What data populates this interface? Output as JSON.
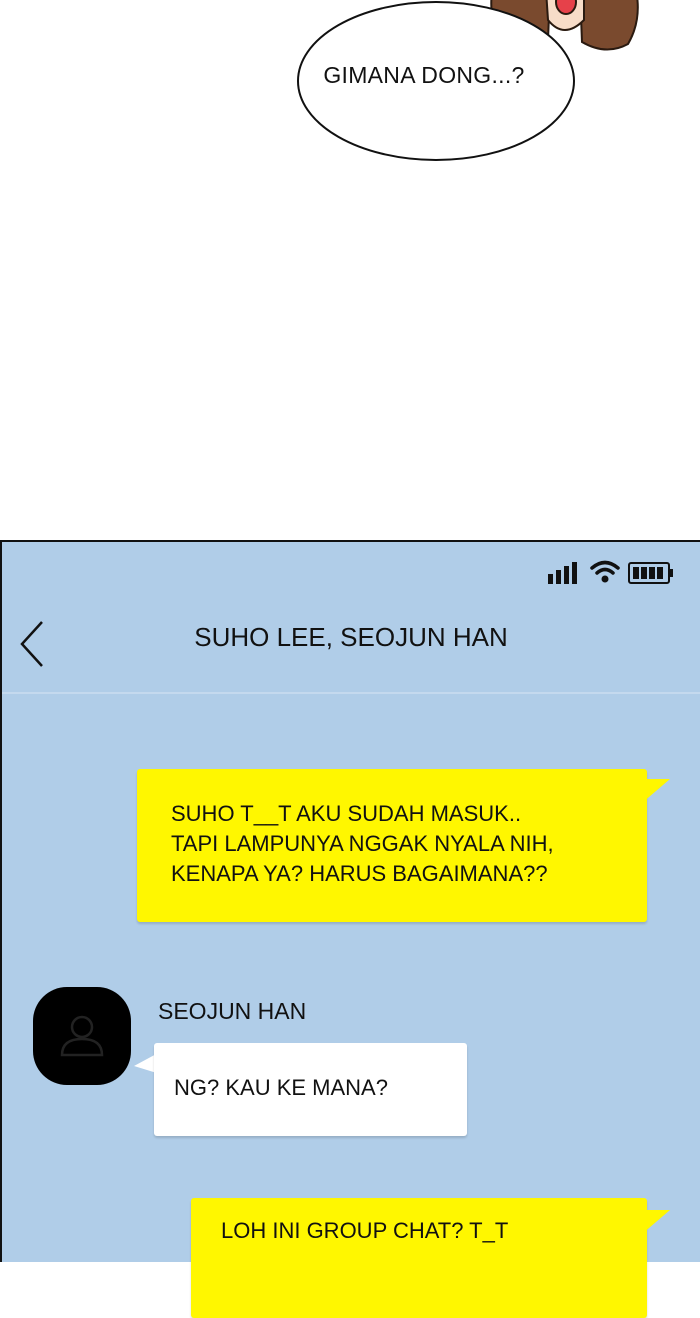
{
  "comic": {
    "speech_text": "GIMANA DONG...?"
  },
  "status_bar": {
    "icons": [
      "signal-icon",
      "wifi-icon",
      "battery-icon"
    ]
  },
  "chat": {
    "title": "SUHO LEE, SEOJUN HAN",
    "messages": [
      {
        "side": "right",
        "lines": [
          "SUHO T__T AKU SUDAH MASUK..",
          "TAPI LAMPUNYA NGGAK NYALA NIH,",
          "KENAPA YA? HARUS BAGAIMANA??"
        ]
      },
      {
        "side": "left",
        "sender": "SEOJUN HAN",
        "lines": [
          "NG? KAU KE MANA?"
        ]
      },
      {
        "side": "right",
        "lines": [
          "LOH INI GROUP CHAT? T_T"
        ]
      }
    ]
  },
  "colors": {
    "chat_background": "#b0cde8",
    "my_bubble": "#fff700",
    "other_bubble": "#ffffff",
    "avatar": "#000000"
  }
}
